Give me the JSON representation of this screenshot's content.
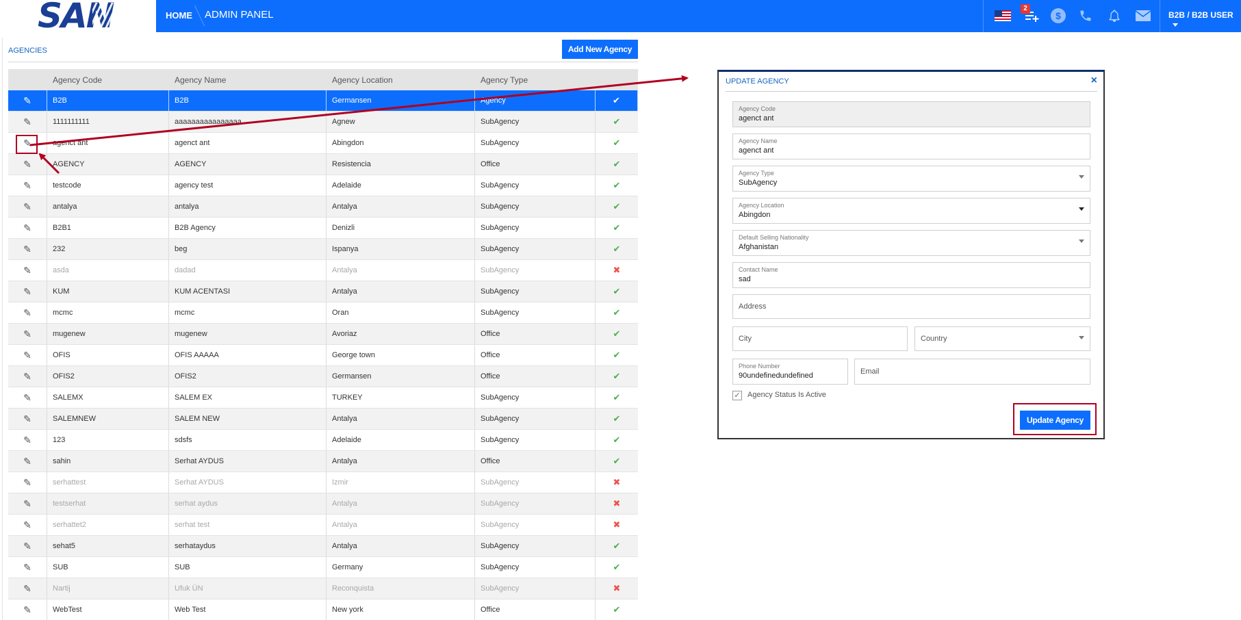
{
  "header": {
    "logo": "SAN",
    "home": "HOME",
    "current": "ADMIN PANEL",
    "notification_count": "2",
    "currency_symbol": "$",
    "user": "B2B / B2B USER"
  },
  "icons": [
    "us-flag-icon",
    "add-list-icon",
    "currency-icon",
    "phone-icon",
    "bell-icon",
    "mail-icon",
    "pencil-icon",
    "check-icon",
    "cross-icon",
    "close-icon",
    "chevron-down-icon"
  ],
  "colors": {
    "primary": "#0d6efd",
    "logo": "#1a3f95",
    "active_check": "#4caf50",
    "inactive_cross": "#ef5350",
    "annotation": "#b00020"
  },
  "page": {
    "section_title": "AGENCIES",
    "add_button": "Add New Agency"
  },
  "table": {
    "columns": [
      "Agency Code",
      "Agency Name",
      "Agency Location",
      "Agency Type"
    ],
    "rows": [
      {
        "code": "B2B",
        "name": "B2B",
        "location": "Germansen",
        "type": "Agency",
        "active": true,
        "selected": true
      },
      {
        "code": "1111111111",
        "name": "aaaaaaaaaaaaaaaa",
        "location": "Agnew",
        "type": "SubAgency",
        "active": true
      },
      {
        "code": "agenct ant",
        "name": "agenct ant",
        "location": "Abingdon",
        "type": "SubAgency",
        "active": true
      },
      {
        "code": "AGENCY",
        "name": "AGENCY",
        "location": "Resistencia",
        "type": "Office",
        "active": true
      },
      {
        "code": "testcode",
        "name": "agency test",
        "location": "Adelaide",
        "type": "SubAgency",
        "active": true
      },
      {
        "code": "antalya",
        "name": "antalya",
        "location": "Antalya",
        "type": "SubAgency",
        "active": true
      },
      {
        "code": "B2B1",
        "name": "B2B Agency",
        "location": "Denizli",
        "type": "SubAgency",
        "active": true
      },
      {
        "code": "232",
        "name": "beg",
        "location": "Ispanya",
        "type": "SubAgency",
        "active": true
      },
      {
        "code": "asda",
        "name": "dadad",
        "location": "Antalya",
        "type": "SubAgency",
        "active": false
      },
      {
        "code": "KUM",
        "name": "KUM ACENTASI",
        "location": "Antalya",
        "type": "SubAgency",
        "active": true
      },
      {
        "code": "mcmc",
        "name": "mcmc",
        "location": "Oran",
        "type": "SubAgency",
        "active": true
      },
      {
        "code": "mugenew",
        "name": "mugenew",
        "location": "Avoriaz",
        "type": "Office",
        "active": true
      },
      {
        "code": "OFIS",
        "name": "OFIS AAAAA",
        "location": "George town",
        "type": "Office",
        "active": true
      },
      {
        "code": "OFIS2",
        "name": "OFIS2",
        "location": "Germansen",
        "type": "Office",
        "active": true
      },
      {
        "code": "SALEMX",
        "name": "SALEM EX",
        "location": "TURKEY",
        "type": "SubAgency",
        "active": true
      },
      {
        "code": "SALEMNEW",
        "name": "SALEM NEW",
        "location": "Antalya",
        "type": "SubAgency",
        "active": true
      },
      {
        "code": "123",
        "name": "sdsfs",
        "location": "Adelaide",
        "type": "SubAgency",
        "active": true
      },
      {
        "code": "sahin",
        "name": "Serhat AYDUS",
        "location": "Antalya",
        "type": "Office",
        "active": true
      },
      {
        "code": "serhattest",
        "name": "Serhat AYDUS",
        "location": "Izmir",
        "type": "SubAgency",
        "active": false
      },
      {
        "code": "testserhat",
        "name": "serhat aydus",
        "location": "Antalya",
        "type": "SubAgency",
        "active": false
      },
      {
        "code": "serhattet2",
        "name": "serhat test",
        "location": "Antalya",
        "type": "SubAgency",
        "active": false
      },
      {
        "code": "sehat5",
        "name": "serhataydus",
        "location": "Antalya",
        "type": "SubAgency",
        "active": true
      },
      {
        "code": "SUB",
        "name": "SUB",
        "location": "Germany",
        "type": "SubAgency",
        "active": true
      },
      {
        "code": "Nartij",
        "name": "Ufuk ÜN",
        "location": "Reconquista",
        "type": "SubAgency",
        "active": false
      },
      {
        "code": "WebTest",
        "name": "Web Test",
        "location": "New york",
        "type": "Office",
        "active": true
      }
    ]
  },
  "modal": {
    "title": "UPDATE AGENCY",
    "close": "×",
    "agency_code_label": "Agency Code",
    "agency_code": "agenct ant",
    "agency_name_label": "Agency Name",
    "agency_name": "agenct ant",
    "agency_type_label": "Agency Type",
    "agency_type": "SubAgency",
    "agency_location_label": "Agency Location",
    "agency_location": "Abingdon",
    "nationality_label": "Default Selling Nationality",
    "nationality": "Afghanistan",
    "contact_label": "Contact Name",
    "contact": "sad",
    "address_placeholder": "Address",
    "city_placeholder": "City",
    "country_placeholder": "Country",
    "phone_label": "Phone Number",
    "phone": "90undefinedundefined",
    "email_placeholder": "Email",
    "status_label": "Agency Status Is Active",
    "status_checked": true,
    "update_button": "Update Agency"
  }
}
